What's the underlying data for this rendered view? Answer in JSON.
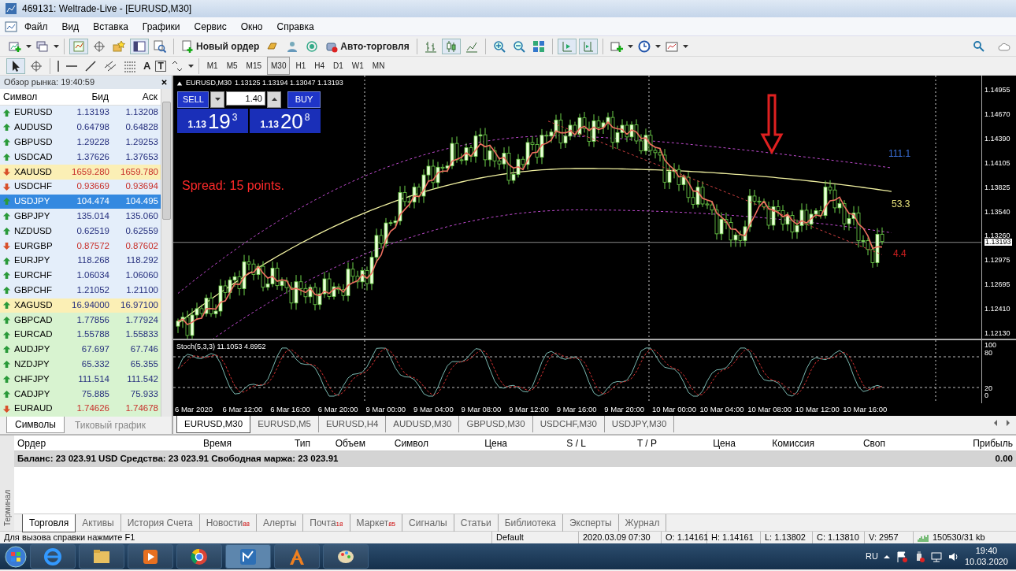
{
  "window": {
    "title": "469131: Weltrade-Live - [EURUSD,M30]"
  },
  "menu": [
    "Файл",
    "Вид",
    "Вставка",
    "Графики",
    "Сервис",
    "Окно",
    "Справка"
  ],
  "toolbar": {
    "new_order": "Новый ордер",
    "autotrading": "Авто-торговля"
  },
  "drawing_tools": {
    "text": "A",
    "label": "T"
  },
  "timeframes": [
    {
      "label": "M1",
      "selected": false
    },
    {
      "label": "M5",
      "selected": false
    },
    {
      "label": "M15",
      "selected": false
    },
    {
      "label": "M30",
      "selected": true
    },
    {
      "label": "H1",
      "selected": false
    },
    {
      "label": "H4",
      "selected": false
    },
    {
      "label": "D1",
      "selected": false
    },
    {
      "label": "W1",
      "selected": false
    },
    {
      "label": "MN",
      "selected": false
    }
  ],
  "market_watch": {
    "title": "Обзор рынка: 19:40:59",
    "columns": [
      "Символ",
      "Бид",
      "Аск"
    ],
    "rows": [
      {
        "symbol": "EURUSD",
        "bid": "1.13193",
        "ask": "1.13208",
        "rising": true,
        "kind": "major",
        "selected": false
      },
      {
        "symbol": "AUDUSD",
        "bid": "0.64798",
        "ask": "0.64828",
        "rising": true,
        "kind": "major",
        "selected": false
      },
      {
        "symbol": "GBPUSD",
        "bid": "1.29228",
        "ask": "1.29253",
        "rising": true,
        "kind": "major",
        "selected": false
      },
      {
        "symbol": "USDCAD",
        "bid": "1.37626",
        "ask": "1.37653",
        "rising": true,
        "kind": "major",
        "selected": false
      },
      {
        "symbol": "XAUUSD",
        "bid": "1659.280",
        "ask": "1659.780",
        "rising": false,
        "kind": "metal",
        "selected": false
      },
      {
        "symbol": "USDCHF",
        "bid": "0.93669",
        "ask": "0.93694",
        "rising": false,
        "kind": "major",
        "selected": false
      },
      {
        "symbol": "USDJPY",
        "bid": "104.474",
        "ask": "104.495",
        "rising": true,
        "kind": "major",
        "selected": true
      },
      {
        "symbol": "GBPJPY",
        "bid": "135.014",
        "ask": "135.060",
        "rising": true,
        "kind": "major",
        "selected": false
      },
      {
        "symbol": "NZDUSD",
        "bid": "0.62519",
        "ask": "0.62559",
        "rising": true,
        "kind": "major",
        "selected": false
      },
      {
        "symbol": "EURGBP",
        "bid": "0.87572",
        "ask": "0.87602",
        "rising": false,
        "kind": "major",
        "selected": false
      },
      {
        "symbol": "EURJPY",
        "bid": "118.268",
        "ask": "118.292",
        "rising": true,
        "kind": "major",
        "selected": false
      },
      {
        "symbol": "EURCHF",
        "bid": "1.06034",
        "ask": "1.06060",
        "rising": true,
        "kind": "major",
        "selected": false
      },
      {
        "symbol": "GBPCHF",
        "bid": "1.21052",
        "ask": "1.21100",
        "rising": true,
        "kind": "major",
        "selected": false
      },
      {
        "symbol": "XAGUSD",
        "bid": "16.94000",
        "ask": "16.97100",
        "rising": true,
        "kind": "metal",
        "selected": false
      },
      {
        "symbol": "GBPCAD",
        "bid": "1.77856",
        "ask": "1.77924",
        "rising": true,
        "kind": "cross",
        "selected": false
      },
      {
        "symbol": "EURCAD",
        "bid": "1.55788",
        "ask": "1.55833",
        "rising": true,
        "kind": "cross",
        "selected": false
      },
      {
        "symbol": "AUDJPY",
        "bid": "67.697",
        "ask": "67.746",
        "rising": true,
        "kind": "cross",
        "selected": false
      },
      {
        "symbol": "NZDJPY",
        "bid": "65.332",
        "ask": "65.355",
        "rising": true,
        "kind": "cross",
        "selected": false
      },
      {
        "symbol": "CHFJPY",
        "bid": "111.514",
        "ask": "111.542",
        "rising": true,
        "kind": "cross",
        "selected": false
      },
      {
        "symbol": "CADJPY",
        "bid": "75.885",
        "ask": "75.933",
        "rising": true,
        "kind": "cross",
        "selected": false
      },
      {
        "symbol": "EURAUD",
        "bid": "1.74626",
        "ask": "1.74678",
        "rising": false,
        "kind": "cross",
        "selected": false
      }
    ],
    "tabs": [
      {
        "label": "Символы",
        "selected": true
      },
      {
        "label": "Тиковый график",
        "selected": false
      }
    ]
  },
  "chart": {
    "symbol": "EURUSD,M30",
    "ohlc": "1.13125 1.13194 1.13047 1.13193",
    "one_click": {
      "sell": "SELL",
      "buy": "BUY",
      "lot": "1.40",
      "sell_price": {
        "prefix": "1.13",
        "big": "19",
        "small": "3"
      },
      "buy_price": {
        "prefix": "1.13",
        "big": "20",
        "small": "8"
      }
    },
    "spread": "Spread: 15 points.",
    "level_labels": [
      {
        "text": "111.1",
        "color": "#3a6fd8"
      },
      {
        "text": "53.3",
        "color": "#e6e07a"
      },
      {
        "text": "4.4",
        "color": "#d02020"
      }
    ],
    "price_labels": [
      "1.14955",
      "1.14670",
      "1.14390",
      "1.14105",
      "1.13825",
      "1.13540",
      "1.13260",
      "1.12975",
      "1.12695",
      "1.12410",
      "1.12130"
    ],
    "current_price": "1.13193",
    "indicator": "Stoch(5,3,3) 11.1053 4.8952",
    "indicator_labels": [
      "100",
      "80",
      "20",
      "0"
    ],
    "time_labels": [
      "6 Mar 2020",
      "6 Mar 12:00",
      "6 Mar 16:00",
      "6 Mar 20:00",
      "9 Mar 00:00",
      "9 Mar 04:00",
      "9 Mar 08:00",
      "9 Mar 12:00",
      "9 Mar 16:00",
      "9 Mar 20:00",
      "10 Mar 00:00",
      "10 Mar 04:00",
      "10 Mar 08:00",
      "10 Mar 12:00",
      "10 Mar 16:00"
    ],
    "tabs": [
      {
        "label": "EURUSD,M30",
        "selected": true
      },
      {
        "label": "EURUSD,M5",
        "selected": false
      },
      {
        "label": "EURUSD,H4",
        "selected": false
      },
      {
        "label": "AUDUSD,M30",
        "selected": false
      },
      {
        "label": "GBPUSD,M30",
        "selected": false
      },
      {
        "label": "USDCHF,M30",
        "selected": false
      },
      {
        "label": "USDJPY,M30",
        "selected": false
      }
    ]
  },
  "terminal": {
    "side_label": "Терминал",
    "columns": [
      "Ордер",
      "Время",
      "Тип",
      "Объем",
      "Символ",
      "Цена",
      "S / L",
      "T / P",
      "Цена",
      "Комиссия",
      "Своп",
      "Прибыль"
    ],
    "balance": "Баланс: 23 023.91 USD  Средства: 23 023.91  Свободная маржа: 23 023.91",
    "profit": "0.00",
    "tabs": [
      {
        "label": "Торговля",
        "selected": true
      },
      {
        "label": "Активы",
        "selected": false
      },
      {
        "label": "История Счета",
        "selected": false
      },
      {
        "label": "Новости",
        "count": "88",
        "selected": false
      },
      {
        "label": "Алерты",
        "selected": false
      },
      {
        "label": "Почта",
        "count": "18",
        "selected": false
      },
      {
        "label": "Маркет",
        "count": "85",
        "selected": false
      },
      {
        "label": "Сигналы",
        "selected": false
      },
      {
        "label": "Статьи",
        "selected": false
      },
      {
        "label": "Библиотека",
        "selected": false
      },
      {
        "label": "Эксперты",
        "selected": false
      },
      {
        "label": "Журнал",
        "selected": false
      }
    ]
  },
  "status_bar": {
    "help": "Для вызова справки нажмите F1",
    "profile": "Default",
    "bar_time": "2020.03.09 07:30",
    "open": "O: 1.14161",
    "high": "H: 1.14161",
    "low": "L: 1.13802",
    "close": "C: 1.13810",
    "volume": "V: 2957",
    "traffic": "150530/31 kb"
  },
  "taskbar": {
    "language": "RU",
    "time": "19:40",
    "date": "10.03.2020"
  }
}
